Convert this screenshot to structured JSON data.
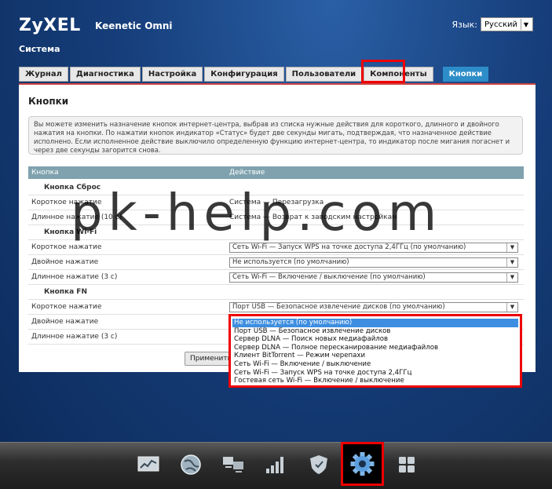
{
  "header": {
    "brand": "ZyXEL",
    "model": "Keenetic Omni",
    "lang_label": "Язык:",
    "lang_value": "Русский",
    "section": "Система"
  },
  "tabs": [
    "Журнал",
    "Диагностика",
    "Настройка",
    "Конфигурация",
    "Пользователи",
    "Компоненты",
    "Кнопки"
  ],
  "active_tab": "Кнопки",
  "panel": {
    "title": "Кнопки",
    "info": "Вы можете изменить назначение кнопок интернет-центра, выбрав из списка нужные действия для короткого, длинного и двойного нажатия на кнопки. По нажатии кнопок индикатор «Статус» будет две секунды мигать, подтверждая, что назначенное действие исполнено. Если исполненное действие выключило определенную функцию интернет-центра, то индикатор после мигания погаснет и через две секунды загорится снова.",
    "col_button": "Кнопка",
    "col_action": "Действие",
    "apply": "Применить"
  },
  "rows": {
    "g1": "Кнопка Сброс",
    "r1_lbl": "Короткое нажатие",
    "r1_val": "Система — Перезагрузка",
    "r2_lbl": "Длинное нажатие (10 с)",
    "r2_val": "Система — Возврат к заводским настройкам",
    "g2": "Кнопка Wi-Fi",
    "r3_lbl": "Короткое нажатие",
    "r3_val": "Сеть Wi-Fi — Запуск WPS на точке доступа 2,4ГГц (по умолчанию)",
    "r4_lbl": "Двойное нажатие",
    "r4_val": "Не используется (по умолчанию)",
    "r5_lbl": "Длинное нажатие (3 с)",
    "r5_val": "Сеть Wi-Fi — Включение / выключение (по умолчанию)",
    "g3": "Кнопка FN",
    "r6_lbl": "Короткое нажатие",
    "r6_val": "Порт USB — Безопасное извлечение дисков (по умолчанию)",
    "r7_lbl": "Двойное нажатие",
    "r8_lbl": "Длинное нажатие (3 с)"
  },
  "dropdown_options": [
    "Не используется (по умолчанию)",
    "Порт USB — Безопасное извлечение дисков",
    "Сервер DLNA — Поиск новых медиафайлов",
    "Сервер DLNA — Полное пересканирование медиафайлов",
    "Клиент BitTorrent — Режим черепахи",
    "Сеть Wi-Fi — Включение / выключение",
    "Сеть Wi-Fi — Запуск WPS на точке доступа 2,4ГГц",
    "Гостевая сеть Wi-Fi — Включение / выключение"
  ],
  "watermark": "pk-help.com",
  "dock_icons": [
    "monitor-chart-icon",
    "globe-icon",
    "network-computers-icon",
    "signal-bars-icon",
    "shield-icon",
    "gear-icon",
    "apps-grid-icon"
  ],
  "colors": {
    "accent": "#2d8dc8",
    "highlight": "#ee0000"
  }
}
